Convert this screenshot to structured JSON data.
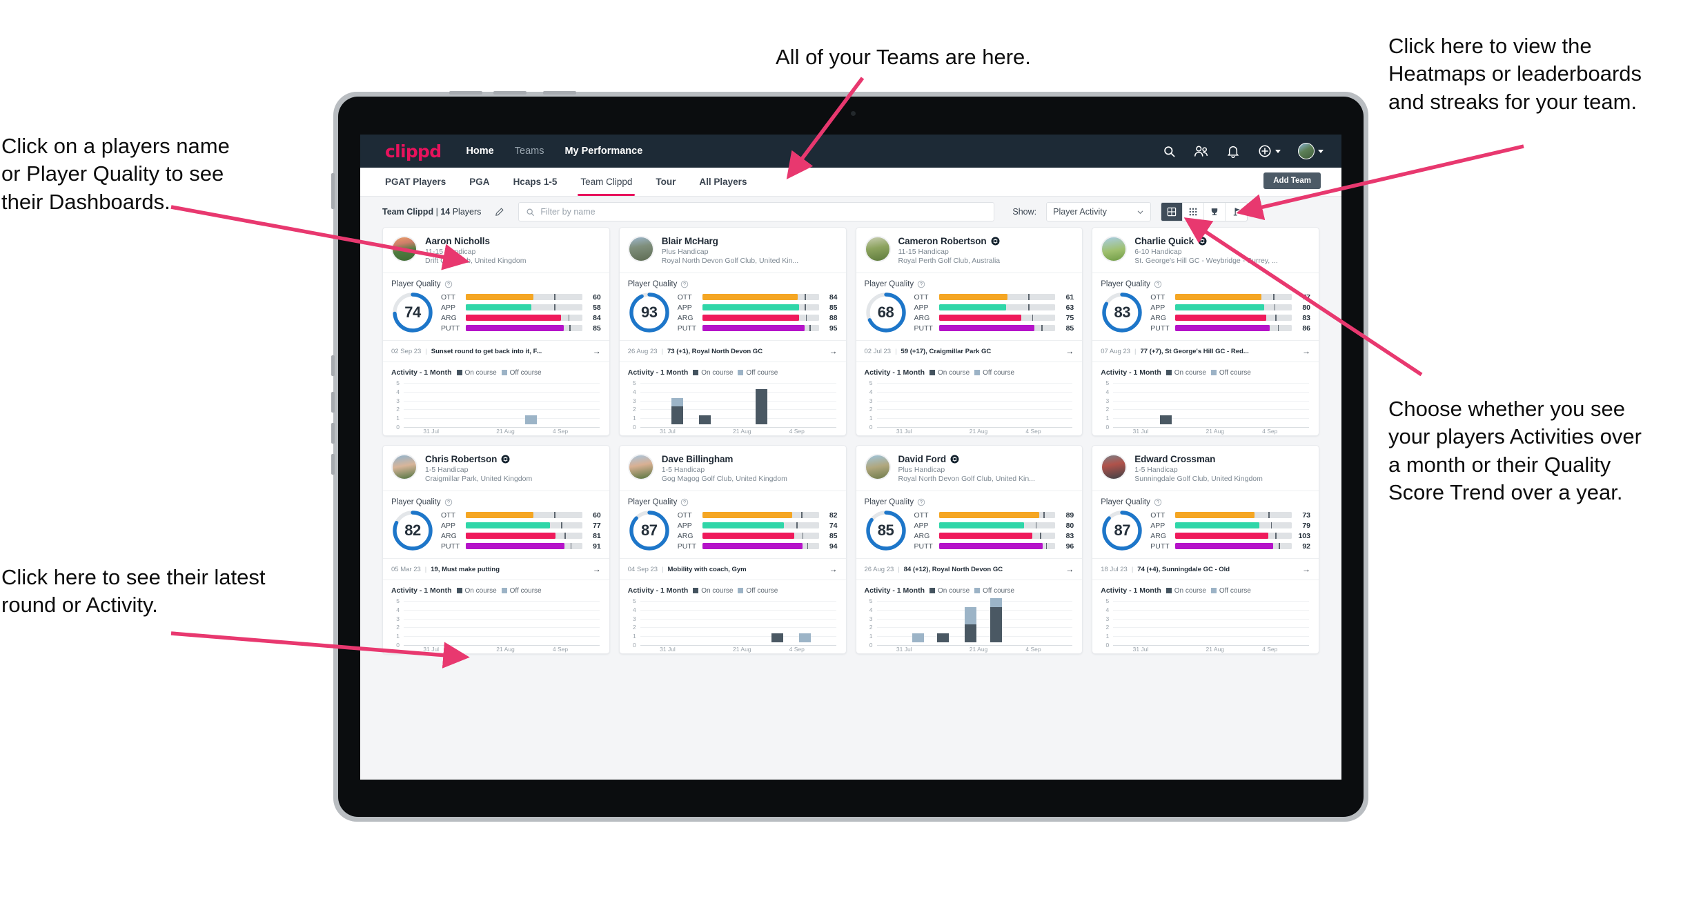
{
  "annotations": {
    "left_top": "Click on a players name\nor Player Quality to see\ntheir Dashboards.",
    "center_top": "All of your Teams are here.",
    "right_top": "Click here to view the\nHeatmaps or leaderboards\nand streaks for your team.",
    "right_mid": "Choose whether you see\nyour players Activities over\na month or their Quality\nScore Trend over a year.",
    "left_bottom": "Click here to see their latest\nround or Activity."
  },
  "navbar": {
    "brand": "clippd",
    "links": [
      {
        "label": "Home",
        "active": true
      },
      {
        "label": "Teams",
        "active": false
      },
      {
        "label": "My Performance",
        "active": true
      }
    ],
    "icons": [
      "search-icon",
      "people-icon",
      "bell-icon",
      "plus-circle-icon",
      "avatar"
    ]
  },
  "tabstrip": {
    "tabs": [
      {
        "label": "PGAT Players",
        "active": false
      },
      {
        "label": "PGA",
        "active": false
      },
      {
        "label": "Hcaps 1-5",
        "active": false
      },
      {
        "label": "Team Clippd",
        "active": true
      },
      {
        "label": "Tour",
        "active": false
      },
      {
        "label": "All Players",
        "active": false
      }
    ],
    "add_team_label": "Add Team"
  },
  "filterbar": {
    "team_name": "Team Clippd",
    "player_count": "14",
    "players_word": "Players",
    "separator": "|",
    "edit_icon": "pencil-icon",
    "search_placeholder": "Filter by name",
    "search_value": "",
    "show_label": "Show:",
    "show_selected": "Player Activity",
    "show_options": [
      "Player Activity",
      "Quality Score Trend"
    ],
    "view_toggles": [
      {
        "name": "grid-view-icon",
        "active": true
      },
      {
        "name": "dense-grid-view-icon",
        "active": false
      },
      {
        "name": "trophy-view-icon",
        "active": false
      },
      {
        "name": "flag-view-icon",
        "active": false
      }
    ]
  },
  "card_labels": {
    "player_quality": "Player Quality",
    "activity_title": "Activity - 1 Month",
    "legend_on": "On course",
    "legend_off": "Off course",
    "metric_labels": [
      "OTT",
      "APP",
      "ARG",
      "PUTT"
    ],
    "y_ticks": [
      "5",
      "4",
      "3",
      "2",
      "1",
      "0"
    ],
    "x_ticks": [
      "31 Jul",
      "21 Aug",
      "4 Sep"
    ]
  },
  "colors": {
    "brand_pink": "#e8125c",
    "navbar_bg": "#1d2a36",
    "ring_blue": "#1d76c9",
    "ott": "#f5a623",
    "app": "#2fd6a8",
    "arg": "#f2informa",
    "arg_hex": "#ef1a5b",
    "putt": "#b513c9",
    "on_course": "#4a5863",
    "off_course": "#9cb4c7"
  },
  "players": [
    {
      "name": "Aaron Nicholls",
      "verified": false,
      "handicap": "11-15 Handicap",
      "club": "Drift Golf Club, United Kingdom",
      "quality": 74,
      "metrics": [
        {
          "label": "OTT",
          "value": 60,
          "fill": 58,
          "tick": 76
        },
        {
          "label": "APP",
          "value": 58,
          "fill": 56,
          "tick": 76
        },
        {
          "label": "ARG",
          "value": 84,
          "fill": 82,
          "tick": 88
        },
        {
          "label": "PUTT",
          "value": 85,
          "fill": 84,
          "tick": 89
        }
      ],
      "round": {
        "date": "02 Sep 23",
        "text": "Sunset round to get back into it, F..."
      },
      "activity": [
        {
          "pos": 62,
          "on": 0,
          "off": 1
        }
      ]
    },
    {
      "name": "Blair McHarg",
      "verified": false,
      "handicap": "Plus Handicap",
      "club": "Royal North Devon Golf Club, United Kin...",
      "quality": 93,
      "metrics": [
        {
          "label": "OTT",
          "value": 84,
          "fill": 82,
          "tick": 88
        },
        {
          "label": "APP",
          "value": 85,
          "fill": 83,
          "tick": 88
        },
        {
          "label": "ARG",
          "value": 88,
          "fill": 83,
          "tick": 89
        },
        {
          "label": "PUTT",
          "value": 95,
          "fill": 88,
          "tick": 92
        }
      ],
      "round": {
        "date": "26 Aug 23",
        "text": "73 (+1), Royal North Devon GC"
      },
      "activity": [
        {
          "pos": 16,
          "on": 2,
          "off": 1
        },
        {
          "pos": 30,
          "on": 1,
          "off": 0
        },
        {
          "pos": 59,
          "on": 4,
          "off": 0
        }
      ]
    },
    {
      "name": "Cameron Robertson",
      "verified": true,
      "handicap": "11-15 Handicap",
      "club": "Royal Perth Golf Club, Australia",
      "quality": 68,
      "metrics": [
        {
          "label": "OTT",
          "value": 61,
          "fill": 59,
          "tick": 77
        },
        {
          "label": "APP",
          "value": 63,
          "fill": 58,
          "tick": 77
        },
        {
          "label": "ARG",
          "value": 75,
          "fill": 71,
          "tick": 80
        },
        {
          "label": "PUTT",
          "value": 85,
          "fill": 82,
          "tick": 88
        }
      ],
      "round": {
        "date": "02 Jul 23",
        "text": "59 (+17), Craigmillar Park GC"
      },
      "activity": []
    },
    {
      "name": "Charlie Quick",
      "verified": true,
      "handicap": "6-10 Handicap",
      "club": "St. George's Hill GC - Weybridge - Surrey, ...",
      "quality": 83,
      "metrics": [
        {
          "label": "OTT",
          "value": 77,
          "fill": 74,
          "tick": 84
        },
        {
          "label": "APP",
          "value": 80,
          "fill": 76,
          "tick": 85
        },
        {
          "label": "ARG",
          "value": 83,
          "fill": 78,
          "tick": 86
        },
        {
          "label": "PUTT",
          "value": 86,
          "fill": 81,
          "tick": 88
        }
      ],
      "round": {
        "date": "07 Aug 23",
        "text": "77 (+7), St George's Hill GC - Red..."
      },
      "activity": [
        {
          "pos": 24,
          "on": 1,
          "off": 0
        }
      ]
    },
    {
      "name": "Chris Robertson",
      "verified": true,
      "handicap": "1-5 Handicap",
      "club": "Craigmillar Park, United Kingdom",
      "quality": 82,
      "metrics": [
        {
          "label": "OTT",
          "value": 60,
          "fill": 58,
          "tick": 76
        },
        {
          "label": "APP",
          "value": 77,
          "fill": 72,
          "tick": 82
        },
        {
          "label": "ARG",
          "value": 81,
          "fill": 77,
          "tick": 85
        },
        {
          "label": "PUTT",
          "value": 91,
          "fill": 85,
          "tick": 90
        }
      ],
      "round": {
        "date": "05 Mar 23",
        "text": "19, Must make putting"
      },
      "activity": []
    },
    {
      "name": "Dave Billingham",
      "verified": false,
      "handicap": "1-5 Handicap",
      "club": "Gog Magog Golf Club, United Kingdom",
      "quality": 87,
      "metrics": [
        {
          "label": "OTT",
          "value": 82,
          "fill": 77,
          "tick": 85
        },
        {
          "label": "APP",
          "value": 74,
          "fill": 70,
          "tick": 81
        },
        {
          "label": "ARG",
          "value": 85,
          "fill": 79,
          "tick": 86
        },
        {
          "label": "PUTT",
          "value": 94,
          "fill": 86,
          "tick": 90
        }
      ],
      "round": {
        "date": "04 Sep 23",
        "text": "Mobility with coach, Gym"
      },
      "activity": [
        {
          "pos": 67,
          "on": 1,
          "off": 0
        },
        {
          "pos": 81,
          "on": 0,
          "off": 1
        }
      ]
    },
    {
      "name": "David Ford",
      "verified": true,
      "handicap": "Plus Handicap",
      "club": "Royal North Devon Golf Club, United Kin...",
      "quality": 85,
      "metrics": [
        {
          "label": "OTT",
          "value": 89,
          "fill": 86,
          "tick": 90
        },
        {
          "label": "APP",
          "value": 80,
          "fill": 73,
          "tick": 83
        },
        {
          "label": "ARG",
          "value": 83,
          "fill": 80,
          "tick": 87
        },
        {
          "label": "PUTT",
          "value": 96,
          "fill": 89,
          "tick": 92
        }
      ],
      "round": {
        "date": "26 Aug 23",
        "text": "84 (+12), Royal North Devon GC"
      },
      "activity": [
        {
          "pos": 18,
          "on": 0,
          "off": 1
        },
        {
          "pos": 31,
          "on": 1,
          "off": 0
        },
        {
          "pos": 45,
          "on": 2,
          "off": 2
        },
        {
          "pos": 58,
          "on": 4,
          "off": 1
        }
      ]
    },
    {
      "name": "Edward Crossman",
      "verified": false,
      "handicap": "1-5 Handicap",
      "club": "Sunningdale Golf Club, United Kingdom",
      "quality": 87,
      "metrics": [
        {
          "label": "OTT",
          "value": 73,
          "fill": 68,
          "tick": 80
        },
        {
          "label": "APP",
          "value": 79,
          "fill": 72,
          "tick": 82
        },
        {
          "label": "ARG",
          "value": 103,
          "fill": 80,
          "tick": 86
        },
        {
          "label": "PUTT",
          "value": 92,
          "fill": 84,
          "tick": 89
        }
      ],
      "round": {
        "date": "18 Jul 23",
        "text": "74 (+4), Sunningdale GC - Old"
      },
      "activity": []
    }
  ]
}
